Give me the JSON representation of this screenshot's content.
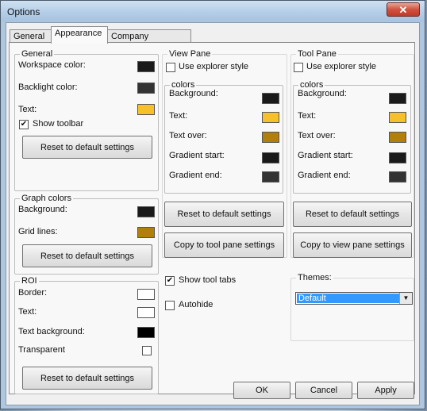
{
  "window": {
    "title": "Options",
    "close_glyph": "✕"
  },
  "tabs": [
    {
      "label": "General"
    },
    {
      "label": "Appearance"
    },
    {
      "label": "Company Information"
    }
  ],
  "general": {
    "title": "General",
    "workspace_label": "Workspace color:",
    "workspace_color": "#1a1a1a",
    "backlight_label": "Backlight color:",
    "backlight_color": "#333333",
    "text_label": "Text:",
    "text_color": "#f5c02c",
    "show_toolbar_label": "Show toolbar",
    "show_toolbar_checked": "✔",
    "reset_label": "Reset to default settings"
  },
  "graph": {
    "title": "Graph colors",
    "background_label": "Background:",
    "background_color": "#1a1a1a",
    "gridlines_label": "Grid lines:",
    "gridlines_color": "#b0800a",
    "reset_label": "Reset to default settings"
  },
  "roi": {
    "title": "ROI",
    "border_label": "Border:",
    "border_color": "#ffffff",
    "text_label": "Text:",
    "text_color": "#ffffff",
    "textbg_label": "Text background:",
    "textbg_color": "#000000",
    "transparent_label": "Transparent",
    "reset_label": "Reset to default settings"
  },
  "view_pane": {
    "title": "View Pane",
    "explorer_label": "Use explorer style",
    "colors_title": "colors",
    "background_label": "Background:",
    "background_color": "#1a1a1a",
    "text_label": "Text:",
    "text_color": "#f5c02c",
    "textover_label": "Text over:",
    "textover_color": "#b0800a",
    "gradstart_label": "Gradient start:",
    "gradstart_color": "#1a1a1a",
    "gradend_label": "Gradient end:",
    "gradend_color": "#333333",
    "reset_label": "Reset to default settings",
    "copy_label": "Copy to tool pane settings"
  },
  "tool_pane": {
    "title": "Tool Pane",
    "explorer_label": "Use explorer style",
    "colors_title": "colors",
    "background_label": "Background:",
    "background_color": "#1a1a1a",
    "text_label": "Text:",
    "text_color": "#f5c02c",
    "textover_label": "Text over:",
    "textover_color": "#b0800a",
    "gradstart_label": "Gradient start:",
    "gradstart_color": "#1a1a1a",
    "gradend_label": "Gradient end:",
    "gradend_color": "#333333",
    "reset_label": "Reset to default settings",
    "copy_label": "Copy to view pane settings"
  },
  "tool_tabs": {
    "show_label": "Show tool tabs",
    "show_checked": "✔",
    "autohide_label": "Autohide"
  },
  "themes": {
    "title": "Themes:",
    "selected": "Default",
    "arrow_glyph": "▼"
  },
  "footer": {
    "ok": "OK",
    "cancel": "Cancel",
    "apply": "Apply"
  }
}
